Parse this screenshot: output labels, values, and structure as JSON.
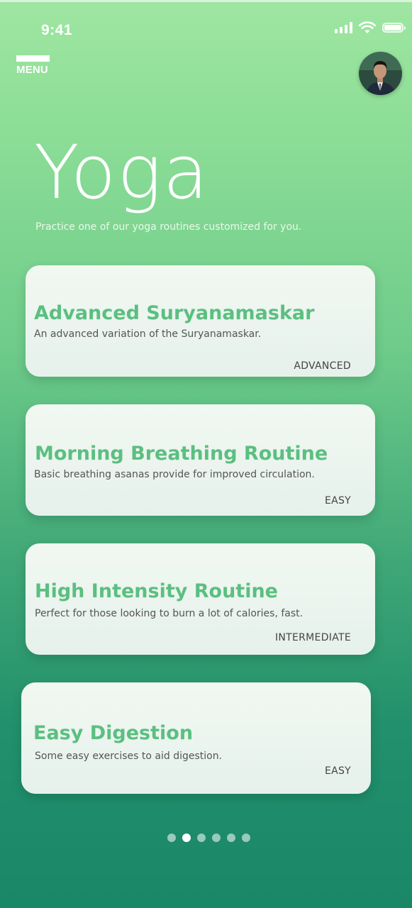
{
  "status_bar": {
    "time": "9:41"
  },
  "header": {
    "menu_label": "MENU",
    "title": "Yoga",
    "subtitle": "Practice one of our yoga routines customized for you."
  },
  "routines": [
    {
      "title": "Advanced Suryanamaskar",
      "description": "An advanced variation of the Suryanamaskar.",
      "level": "ADVANCED"
    },
    {
      "title": "Morning Breathing Routine",
      "description": "Basic breathing asanas provide for improved circulation.",
      "level": "EASY"
    },
    {
      "title": "High Intensity Routine",
      "description": "Perfect for those looking to burn a lot of calories, fast.",
      "level": "INTERMEDIATE"
    },
    {
      "title": "Easy Digestion",
      "description": "Some easy exercises to aid digestion.",
      "level": "EASY"
    }
  ],
  "pagination": {
    "page_count": 6,
    "active_page": 2
  },
  "colors": {
    "accent": "#5bbf80",
    "gradient_top": "#9fe6a2",
    "gradient_bottom": "#1a8767",
    "card_background": "#eef6f0"
  },
  "icons": {
    "menu": "hamburger-menu-icon",
    "signal": "cellular-signal-icon",
    "wifi": "wifi-icon",
    "battery": "battery-icon"
  }
}
